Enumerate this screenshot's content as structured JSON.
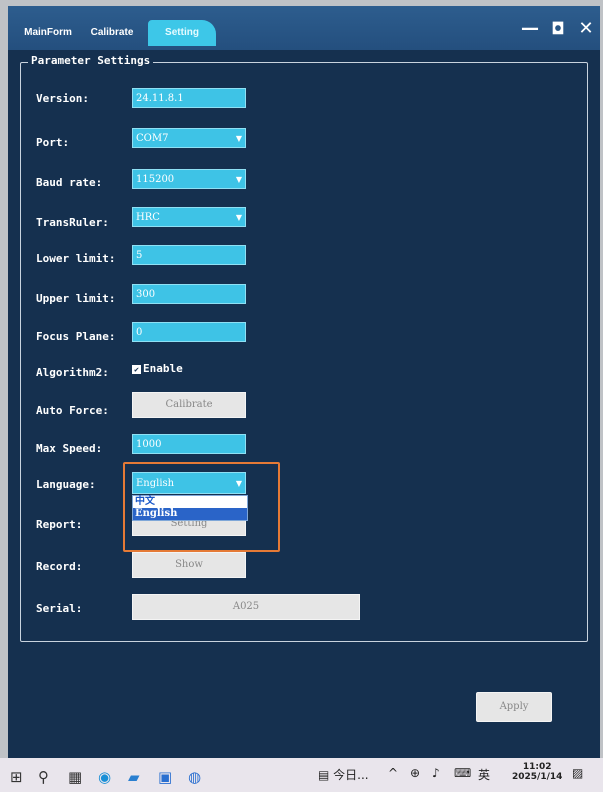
{
  "tabs": [
    "MainForm",
    "Calibrate",
    "Setting"
  ],
  "window_controls": [
    "—",
    "◘",
    "✕"
  ],
  "group_title": "Parameter Settings",
  "fields": {
    "version": {
      "label": "Version:",
      "value": "24.11.8.1"
    },
    "port": {
      "label": "Port:",
      "value": "COM7"
    },
    "baud_rate": {
      "label": "Baud rate:",
      "value": "115200"
    },
    "trans_ruler": {
      "label": "TransRuler:",
      "value": "HRC"
    },
    "lower_limit": {
      "label": "Lower limit:",
      "value": "5"
    },
    "upper_limit": {
      "label": "Upper limit:",
      "value": "300"
    },
    "focus_plane": {
      "label": "Focus Plane:",
      "value": "0"
    },
    "algorithm2": {
      "label": "Algorithm2:",
      "checkbox_label": "Enable",
      "checked": true
    },
    "auto_force": {
      "label": "Auto Force:",
      "button": "Calibrate"
    },
    "max_speed": {
      "label": "Max Speed:",
      "value": "1000"
    },
    "language": {
      "label": "Language:",
      "value": "English",
      "options": [
        "中文",
        "English"
      ]
    },
    "report": {
      "label": "Report:",
      "button": "Setting"
    },
    "record": {
      "label": "Record:",
      "button": "Show"
    },
    "serial": {
      "label": "Serial:",
      "value": "A025"
    }
  },
  "apply_label": "Apply",
  "taskbar": {
    "news": "今日...",
    "ime": "英",
    "time": "11:02",
    "date": "2025/1/14"
  },
  "colors": {
    "background": "#15304f",
    "field": "#3ec3e6",
    "highlight": "#e57a36"
  }
}
